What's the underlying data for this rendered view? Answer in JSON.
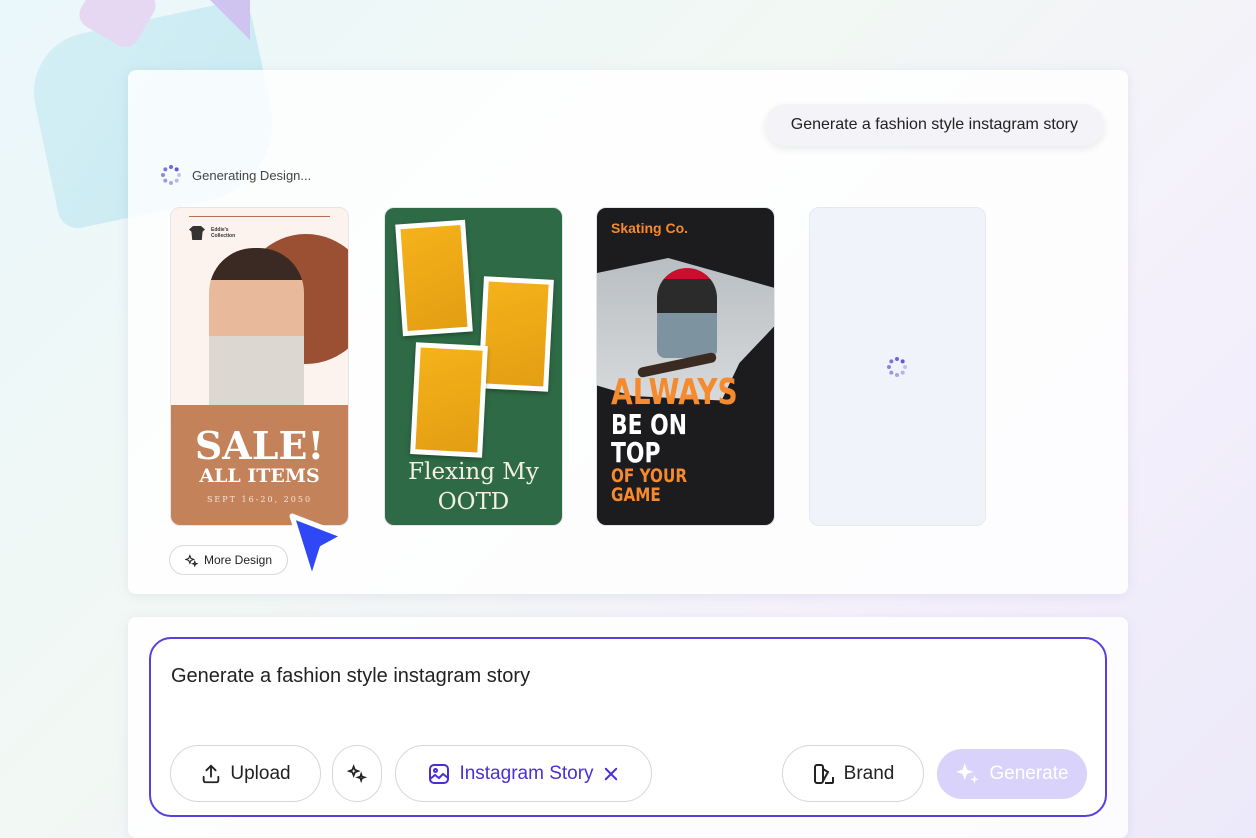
{
  "chat": {
    "prompt_bubble": "Generate a fashion style instagram story",
    "status": "Generating Design..."
  },
  "designs": [
    {
      "brand": "Eddie's Collection",
      "headline": "SALE!",
      "subhead": "ALL ITEMS",
      "dates": "SEPT 16-20, 2050"
    },
    {
      "title_line1": "Flexing My",
      "title_line2": "OOTD"
    },
    {
      "brand": "Skating Co.",
      "line1": "ALWAYS",
      "line2": "BE ON TOP",
      "line3": "OF YOUR GAME"
    },
    {
      "state": "loading"
    }
  ],
  "more_design_label": "More Design",
  "composer": {
    "input_value": "Generate a fashion style instagram story",
    "upload_label": "Upload",
    "format_chip": "Instagram Story",
    "brand_label": "Brand",
    "generate_label": "Generate"
  },
  "colors": {
    "accent": "#5a3fe0",
    "generate_disabled": "#d9d2fb",
    "cursor": "#2f47f5"
  }
}
